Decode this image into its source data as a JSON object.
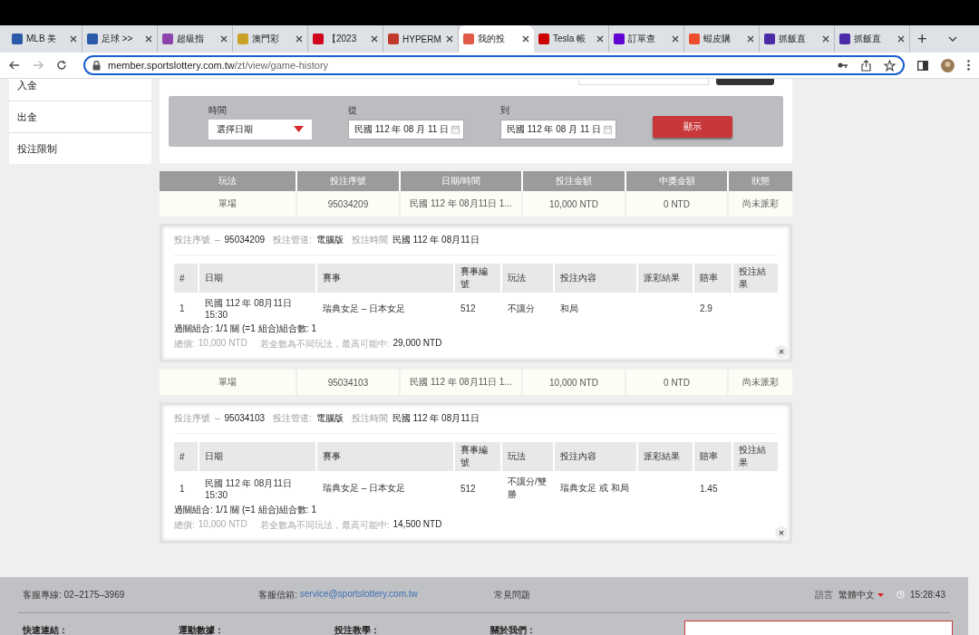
{
  "browser": {
    "tabs": [
      {
        "title": "MLB 美",
        "color": "#2b5aa8",
        "selected": false
      },
      {
        "title": "足球 >>",
        "color": "#2b5aa8",
        "selected": false
      },
      {
        "title": "超級指",
        "color": "#8e44ad",
        "selected": false
      },
      {
        "title": "澳門彩",
        "color": "#c9a227",
        "selected": false
      },
      {
        "title": "【2023",
        "color": "#d0021b",
        "selected": false
      },
      {
        "title": "HYPERM",
        "color": "#c0392b",
        "selected": false
      },
      {
        "title": "我的投",
        "color": "#e05a47",
        "selected": true
      },
      {
        "title": "Tesla 帳",
        "color": "#cc0000",
        "selected": false
      },
      {
        "title": "訂單查",
        "color": "#6001d2",
        "selected": false
      },
      {
        "title": "蝦皮購",
        "color": "#ee4d2d",
        "selected": false
      },
      {
        "title": "抓飯直",
        "color": "#4b2aa8",
        "selected": false
      },
      {
        "title": "抓飯直",
        "color": "#4b2aa8",
        "selected": false
      }
    ],
    "new_tab": "+",
    "url_host": "member.sportslottery.com.tw",
    "url_path": "/zt/view/game-history"
  },
  "sidebar": {
    "items": [
      {
        "label": "入金"
      },
      {
        "label": "出金"
      },
      {
        "label": "投注限制"
      }
    ]
  },
  "filter": {
    "time_label": "時間",
    "time_value": "選擇日期",
    "from_label": "從",
    "from_value": "民國 112 年 08 月 11 日",
    "to_label": "到",
    "to_value": "民國 112 年 08 月 11 日",
    "show_button": "顯示"
  },
  "history": {
    "columns": [
      "玩法",
      "投注序號",
      "日期/時間",
      "投注金額",
      "中獎金額",
      "狀態"
    ],
    "bets": [
      {
        "summary": [
          "單場",
          "95034209",
          "民國 112 年 08月11日 1...",
          "10,000 NTD",
          "0 NTD",
          "尚未派彩"
        ],
        "detail": {
          "info": [
            {
              "label": "投注序號",
              "sep": "–",
              "value": "95034209"
            },
            {
              "label": "投注管道:",
              "value": "電腦版"
            },
            {
              "label": "投注時間",
              "value": "民國 112 年 08月11日"
            }
          ],
          "columns": [
            "#",
            "日期",
            "賽事",
            "賽事編號",
            "玩法",
            "投注內容",
            "派彩結果",
            "賠率",
            "投注結果"
          ],
          "rows": [
            [
              "1",
              "民國 112 年 08月11日 15:30",
              "瑞典女足 – 日本女足",
              "512",
              "不讓分",
              "和局",
              "",
              "2.9",
              ""
            ]
          ],
          "combo": "過關組合: 1/1 關 (=1 組合)組合數: 1",
          "total_label": "總價:",
          "total": "10,000 NTD",
          "max_label": "若全數為不同玩法，最高可能中:",
          "max": "29,000 NTD",
          "close": "×"
        }
      },
      {
        "summary": [
          "單場",
          "95034103",
          "民國 112 年 08月11日 1...",
          "10,000 NTD",
          "0 NTD",
          "尚未派彩"
        ],
        "detail": {
          "info": [
            {
              "label": "投注序號",
              "sep": "–",
              "value": "95034103"
            },
            {
              "label": "投注管道:",
              "value": "電腦版"
            },
            {
              "label": "投注時間",
              "value": "民國 112 年 08月11日"
            }
          ],
          "columns": [
            "#",
            "日期",
            "賽事",
            "賽事編號",
            "玩法",
            "投注內容",
            "派彩結果",
            "賠率",
            "投注結果"
          ],
          "rows": [
            [
              "1",
              "民國 112 年 08月11日 15:30",
              "瑞典女足 – 日本女足",
              "512",
              "不讓分/雙勝",
              "瑞典女足 或 和局",
              "",
              "1.45",
              ""
            ]
          ],
          "combo": "過關組合: 1/1 關 (=1 組合)組合數: 1",
          "total_label": "總價:",
          "total": "10,000 NTD",
          "max_label": "若全數為不同玩法，最高可能中:",
          "max": "14,500 NTD",
          "close": "×"
        }
      }
    ]
  },
  "footer": {
    "phone": "客服專線: 02–2175–3969",
    "email_label": "客服信箱:",
    "email": "service@sportslottery.com.tw",
    "faq": "常見問題",
    "lang_label": "語言",
    "lang": "繁體中文",
    "time": "15:28:43",
    "links": [
      "快速連結：",
      "運動數據：",
      "投注教學：",
      "關於我們："
    ]
  }
}
